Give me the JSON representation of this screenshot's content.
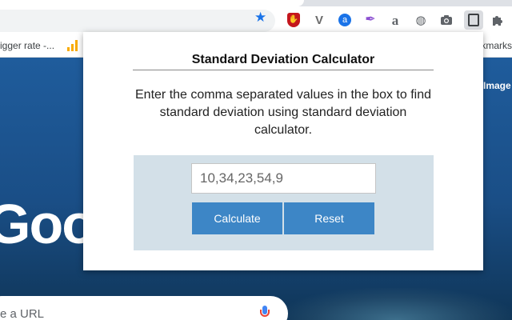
{
  "browser": {
    "bookmark_left": "igger rate -...",
    "bookmark_right": "kmarks",
    "extensions": {
      "ublock": "✋",
      "v": "V",
      "a_circle": "a",
      "feather": "✒",
      "a_grey": "a",
      "globe": "◍",
      "camera": "📷",
      "calc": "▦",
      "puzzle": "✱"
    }
  },
  "page": {
    "logo_text": "Goo",
    "images_link": "Image",
    "search_placeholder": "e a URL"
  },
  "popup": {
    "title": "Standard Deviation Calculator",
    "description": "Enter the comma separated values in the box to find standard deviation using standard deviation calculator.",
    "input_placeholder": "10,34,23,54,9",
    "calculate_label": "Calculate",
    "reset_label": "Reset"
  },
  "colors": {
    "accent_button": "#3d86c6",
    "panel_bg": "#d3e0e8",
    "star": "#1a73e8"
  }
}
